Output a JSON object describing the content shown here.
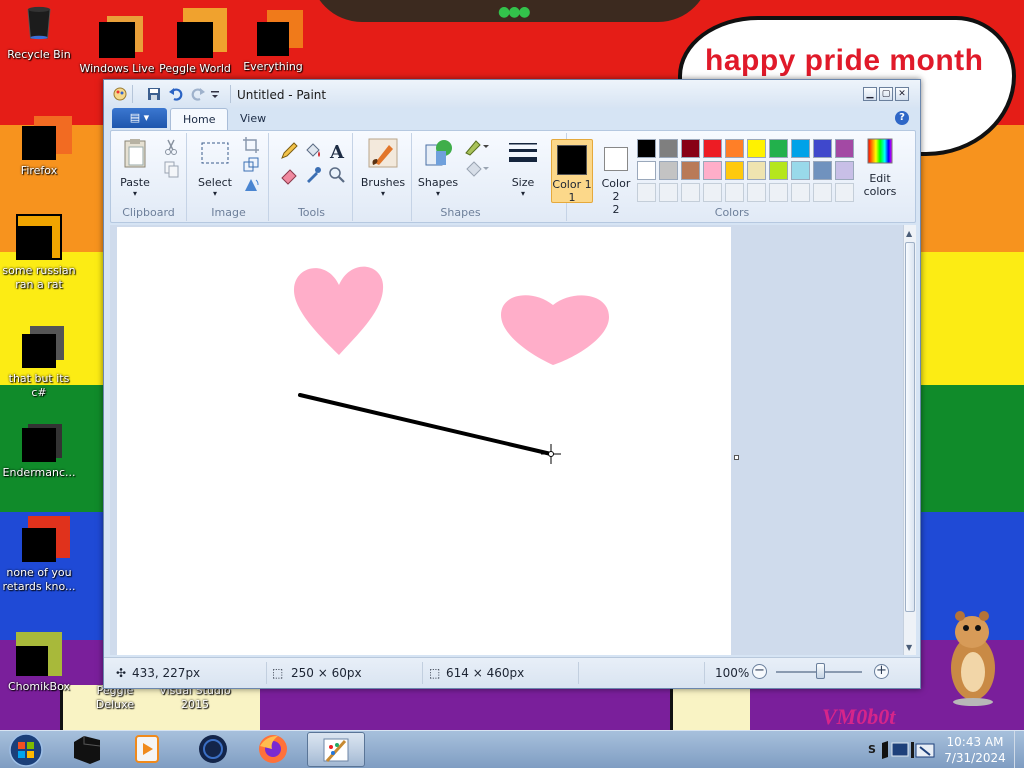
{
  "wallpaper": {
    "colors": [
      "#e51d17",
      "#f7931e",
      "#fcec14",
      "#108b2a",
      "#1f4ad6",
      "#7a1f9b"
    ],
    "cloud_text": "happy pride month",
    "corner_text": "VM0b0t"
  },
  "desktop_icons": [
    {
      "label": "Recycle Bin"
    },
    {
      "label": "Windows Live"
    },
    {
      "label": "Peggle World"
    },
    {
      "label": "Everything"
    },
    {
      "label": "Firefox"
    },
    {
      "label": "some russian ran a rat"
    },
    {
      "label": "that but its c#"
    },
    {
      "label": "Endermanc..."
    },
    {
      "label": "none of you retards kno..."
    },
    {
      "label": "ChomikBox"
    },
    {
      "label": "Peggle Deluxe"
    },
    {
      "label": "Visual Studio 2015"
    }
  ],
  "paint": {
    "title": "Untitled - Paint",
    "tabs": [
      {
        "label": "Home",
        "active": true
      },
      {
        "label": "View",
        "active": false
      }
    ],
    "groups": {
      "clipboard": {
        "label": "Clipboard",
        "paste": "Paste"
      },
      "image": {
        "label": "Image",
        "select": "Select"
      },
      "tools": {
        "label": "Tools"
      },
      "shapes": {
        "label": "Shapes",
        "brushes": "Brushes",
        "shapes": "Shapes"
      },
      "size": {
        "label": "Size"
      },
      "colors": {
        "label": "Colors",
        "color1": "Color 1",
        "color1_num": "1",
        "color2": "Color 2",
        "color2_num": "2",
        "edit": "Edit colors",
        "palette_row1": [
          "#000000",
          "#7f7f7f",
          "#880015",
          "#ed1c24",
          "#ff7f27",
          "#fff200",
          "#22b14c",
          "#00a2e8",
          "#3f48cc",
          "#a349a4"
        ],
        "palette_row2": [
          "#ffffff",
          "#c3c3c3",
          "#b97a57",
          "#ffaec9",
          "#ffc90e",
          "#efe4b0",
          "#b5e61d",
          "#99d9ea",
          "#7092be",
          "#c8bfe7"
        ]
      }
    },
    "canvas": {
      "heart_color": "#ffaec9",
      "line_color": "#000000"
    },
    "status": {
      "cursor_pos": "433, 227px",
      "selection_size": "250 × 60px",
      "image_size": "614 × 460px",
      "zoom": "100%",
      "zoom_minus": "−",
      "zoom_plus": "+"
    }
  },
  "taskbar": {
    "time": "10:43 AM",
    "date": "7/31/2024",
    "apps": [
      "Command Prompt",
      "Media Player",
      "Unknown App",
      "Firefox",
      "Paint"
    ],
    "tray_letter": "S"
  }
}
